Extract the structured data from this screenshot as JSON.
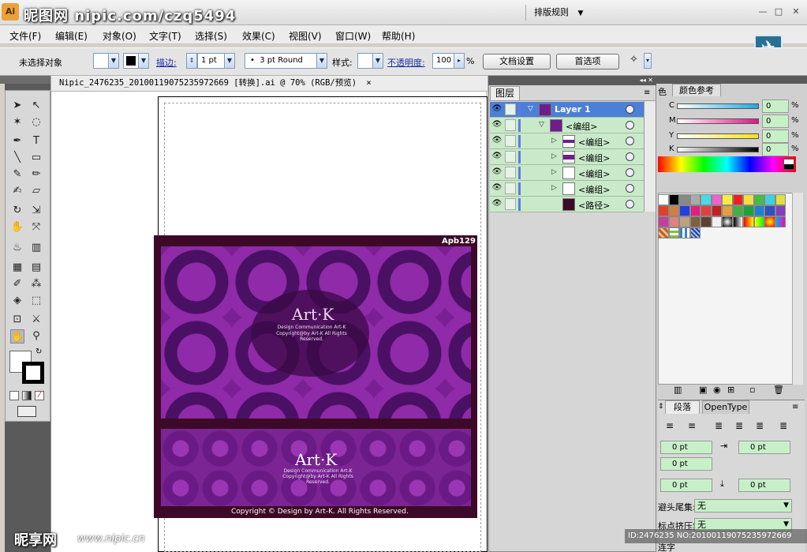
{
  "watermark": {
    "top_text": "昵图网 nipic.com/czq5494",
    "logo": "昵享网",
    "url": "www.nipic.cn",
    "id_text": "ID:2476235 NO:20100119075235972669"
  },
  "titlebar": {
    "app_icon": "Ai",
    "workspace": "排版规则"
  },
  "menu": [
    "文件(F)",
    "编辑(E)",
    "对象(O)",
    "文字(T)",
    "选择(S)",
    "效果(C)",
    "视图(V)",
    "窗口(W)",
    "帮助(H)"
  ],
  "control": {
    "selection": "未选择对象",
    "stroke_label": "描边:",
    "stroke_weight": "1 pt",
    "brush": "3 pt Round",
    "style_label": "样式:",
    "opacity_label": "不透明度:",
    "opacity": "100",
    "percent": "%",
    "doc_setup": "文档设置",
    "preferences": "首选项"
  },
  "document": {
    "tab_title": "Nipic_2476235_20100119075235972669 [转换].ai @ 70% (RGB/预览)",
    "close": "×"
  },
  "artwork": {
    "code": "Apb129",
    "logo": "Art·K",
    "subtitle": "Design Communication Art-K",
    "copyright_small": "Copyright@by Art-K All Rights Reserved.",
    "footer": "Copyright © Design by Art-K. All Rights Reserved."
  },
  "layers": {
    "tab": "图层",
    "rows": [
      {
        "name": "Layer 1",
        "selected": true
      },
      {
        "name": "<编组>"
      },
      {
        "name": "<编组>"
      },
      {
        "name": "<编组>"
      },
      {
        "name": "<编组>"
      },
      {
        "name": "<编组>"
      },
      {
        "name": "<路径>"
      }
    ]
  },
  "color_panel": {
    "tabs": [
      "色",
      "颜色参考"
    ],
    "channels": [
      {
        "label": "C",
        "value": "0"
      },
      {
        "label": "M",
        "value": "0"
      },
      {
        "label": "Y",
        "value": "0"
      },
      {
        "label": "K",
        "value": "0"
      }
    ],
    "percent": "%"
  },
  "paragraph": {
    "tabs": [
      "段落",
      "OpenType"
    ],
    "fields": [
      "0 pt",
      "0 pt",
      "0 pt",
      "0 pt",
      "0 pt"
    ],
    "punct_start_label": "避头尾集:",
    "punct_start_value": "无",
    "punct_compress_label": "标点挤压集:",
    "punct_compress_value": "无",
    "hyphen_label": "连字"
  },
  "colors": {
    "accent": "#4c7fd6",
    "art_bg": "#3c0a26",
    "art_purple": "#7a1f94",
    "layer_green": "#c8eac8"
  }
}
